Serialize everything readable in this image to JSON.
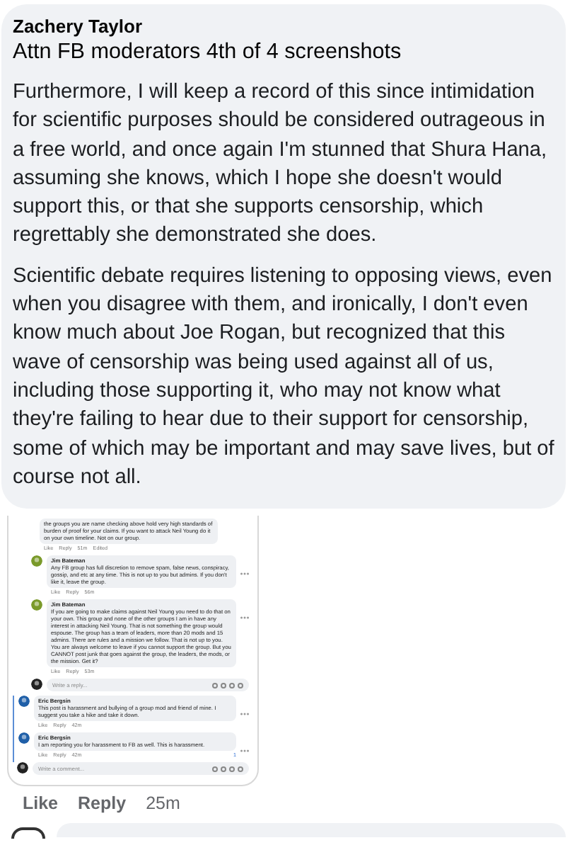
{
  "comment": {
    "author": "Zachery Taylor",
    "title": "Attn FB moderators 4th of 4 screenshots",
    "paragraphs": [
      "Furthermore, I will keep a record of this since intimidation for scientific purposes should be considered outrageous in a free world, and once again I'm stunned that Shura Hana, assuming she knows, which I hope she doesn't would support this, or that she supports censorship, which regrettably she demonstrated she does.",
      "Scientific debate requires listening to opposing views, even when you disagree with them, and ironically, I don't even know much about Joe Rogan, but recognized that this wave of censorship was being used against all of us, including those supporting it, who may not know what they're failing to hear due to their support for censorship, some of which may be important and may save lives, but of course not all."
    ]
  },
  "attachment": {
    "kind": "screenshot",
    "cut_comment": {
      "text": "the groups you are name checking above hold very high standards of burden of proof for your claims. If you want to attack Neil Young do it on your own timeline. Not on our group.",
      "meta": [
        "Like",
        "Reply",
        "51m",
        "Edited"
      ]
    },
    "replies": [
      {
        "author": "Jim Bateman",
        "text": "Any FB group has full discretion to remove spam, false news, conspiracy, gossip, and etc at any time. This is not up to you but admins. If you don't like it, leave the group.",
        "meta": [
          "Like",
          "Reply",
          "56m"
        ]
      },
      {
        "author": "Jim Bateman",
        "text": "If you are going to make claims against Neil Young you need to do that on your own. This group and none of the other groups I am in have any interest in attacking Neil Young. That is not something the group would espouse. The group has a team of leaders, more than 20 mods and 15 admins. There are rules and a mission we follow. That is not up to you. You are always welcome to leave if you cannot support the group. But you CANNOT post junk that goes against the group, the leaders, the mods, or the mission. Get it?",
        "meta": [
          "Like",
          "Reply",
          "53m"
        ]
      }
    ],
    "reply_placeholder": "Write a reply...",
    "comments": [
      {
        "author": "Eric Bergsin",
        "text": "This post is harassment and bullying of a group mod and friend of mine. I suggest you take a hike and take it down.",
        "meta": [
          "Like",
          "Reply",
          "42m"
        ]
      },
      {
        "author": "Eric Bergsin",
        "text": "I am reporting you for harassment to FB as well. This is harassment.",
        "meta": [
          "Like",
          "Reply",
          "42m"
        ],
        "reaction_count": "1"
      }
    ],
    "comment_placeholder": "Write a comment..."
  },
  "actions": [
    "Like",
    "Reply"
  ],
  "time": "25m",
  "composer": {
    "kind": "comment-box"
  }
}
